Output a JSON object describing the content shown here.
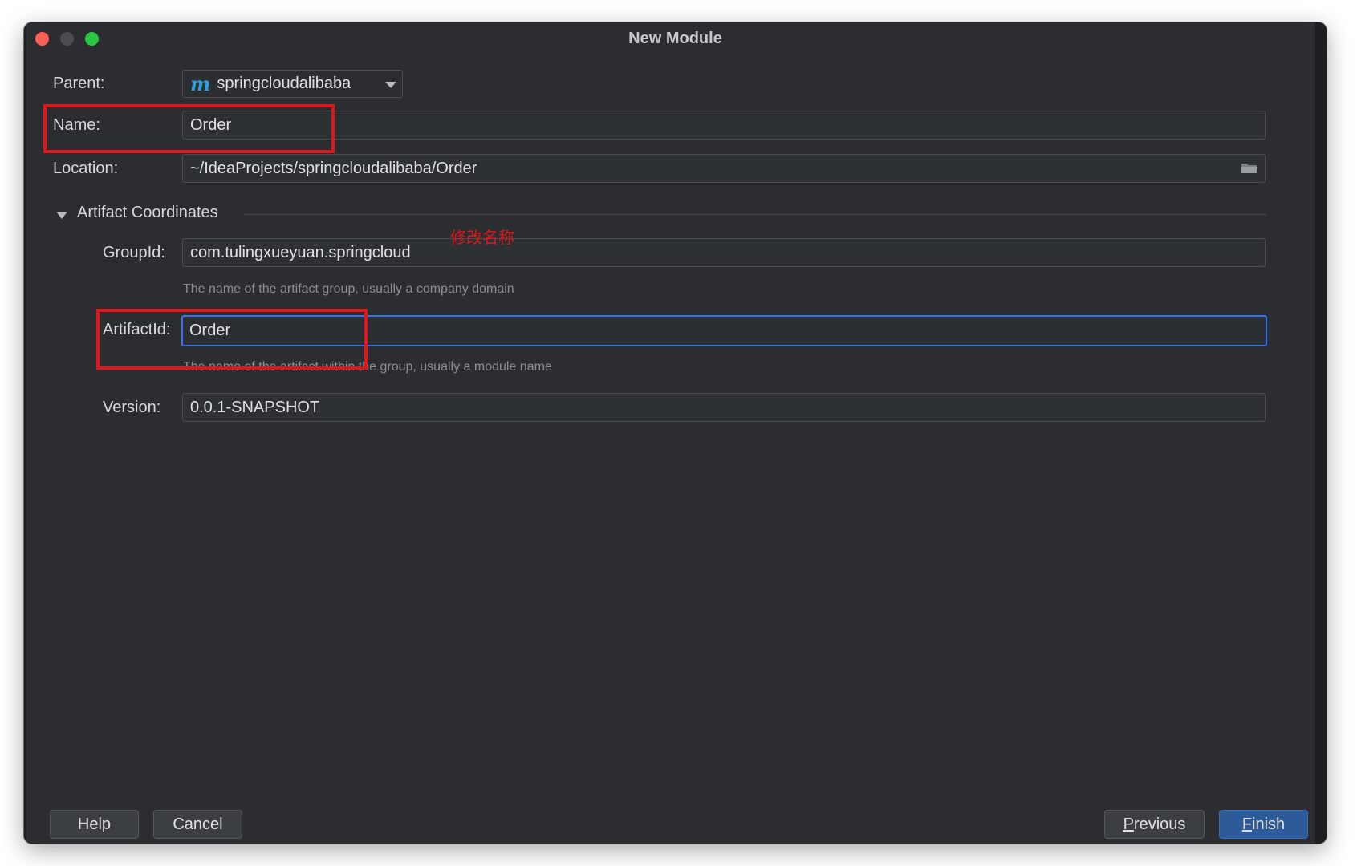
{
  "window": {
    "title": "New Module"
  },
  "form": {
    "parent_label": "Parent:",
    "parent_value": "springcloudalibaba",
    "parent_icon_glyph": "m",
    "name_label": "Name:",
    "name_value": "Order",
    "location_label": "Location:",
    "location_value": "~/IdeaProjects/springcloudalibaba/Order",
    "section_title": "Artifact Coordinates",
    "groupid_label": "GroupId:",
    "groupid_value": "com.tulingxueyuan.springcloud",
    "groupid_hint": "The name of the artifact group, usually a company domain",
    "artifactid_label": "ArtifactId:",
    "artifactid_value": "Order",
    "artifactid_hint": "The name of the artifact within the group, usually a module name",
    "version_label": "Version:",
    "version_value": "0.0.1-SNAPSHOT"
  },
  "annotation": {
    "text": "修改名称",
    "color": "#e0161c"
  },
  "buttons": {
    "help": "Help",
    "cancel": "Cancel",
    "previous_mnemonic": "P",
    "previous_rest": "revious",
    "finish_mnemonic": "F",
    "finish_rest": "inish"
  },
  "colors": {
    "background": "#2b2d30",
    "focus": "#3574f0",
    "primary_button": "#2d5a98"
  },
  "icons": [
    "folder-icon",
    "chevron-down-icon",
    "maven-module-icon",
    "collapse-triangle-icon"
  ]
}
